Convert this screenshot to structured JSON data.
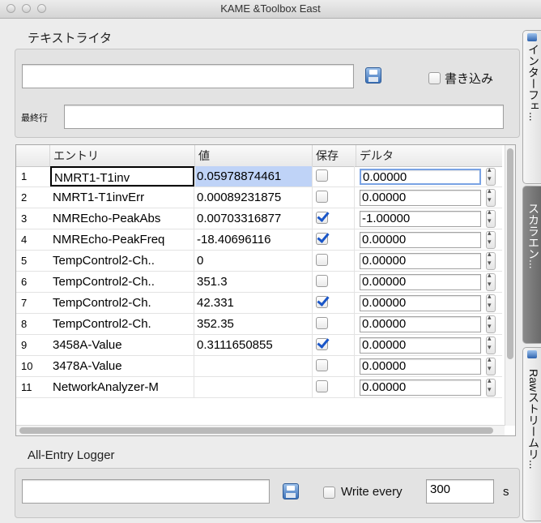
{
  "window": {
    "title": "KAME &Toolbox East"
  },
  "text_writer": {
    "group_title": "テキストライタ",
    "text_value": "",
    "write_label": "書き込み",
    "write_checked": false,
    "last_line_label": "最終行",
    "last_line_value": ""
  },
  "table": {
    "headers": {
      "entry": "エントリ",
      "value": "値",
      "save": "保存",
      "delta": "デルタ"
    },
    "rows": [
      {
        "num": "1",
        "entry": "NMRT1-T1inv",
        "value": "0.05978874461",
        "save": false,
        "delta": "0.00000"
      },
      {
        "num": "2",
        "entry": "NMRT1-T1invErr",
        "value": "0.00089231875",
        "save": false,
        "delta": "0.00000"
      },
      {
        "num": "3",
        "entry": "NMREcho-PeakAbs",
        "value": "0.00703316877",
        "save": true,
        "delta": "-1.00000"
      },
      {
        "num": "4",
        "entry": "NMREcho-PeakFreq",
        "value": "-18.40696116",
        "save": true,
        "delta": "0.00000"
      },
      {
        "num": "5",
        "entry": "TempControl2-Ch..",
        "value": "0",
        "save": false,
        "delta": "0.00000"
      },
      {
        "num": "6",
        "entry": "TempControl2-Ch..",
        "value": "351.3",
        "save": false,
        "delta": "0.00000"
      },
      {
        "num": "7",
        "entry": "TempControl2-Ch.",
        "value": "42.331",
        "save": true,
        "delta": "0.00000"
      },
      {
        "num": "8",
        "entry": "TempControl2-Ch.",
        "value": "352.35",
        "save": false,
        "delta": "0.00000"
      },
      {
        "num": "9",
        "entry": "3458A-Value",
        "value": "0.3111650855",
        "save": true,
        "delta": "0.00000"
      },
      {
        "num": "10",
        "entry": "3478A-Value",
        "value": "",
        "save": false,
        "delta": "0.00000"
      },
      {
        "num": "11",
        "entry": "NetworkAnalyzer-M",
        "value": "",
        "save": false,
        "delta": "0.00000"
      }
    ]
  },
  "logger": {
    "group_title": "All-Entry Logger",
    "path_value": "",
    "write_every_label": "Write every",
    "write_every_checked": false,
    "interval_value": "300",
    "unit": "s"
  },
  "side_tabs": [
    {
      "label": "インターフェ..."
    },
    {
      "label": "スカラエン..."
    },
    {
      "label": "Rawストリームリ..."
    }
  ],
  "icons": {
    "save": "floppy-disk-icon",
    "check": "checkmark-icon"
  }
}
